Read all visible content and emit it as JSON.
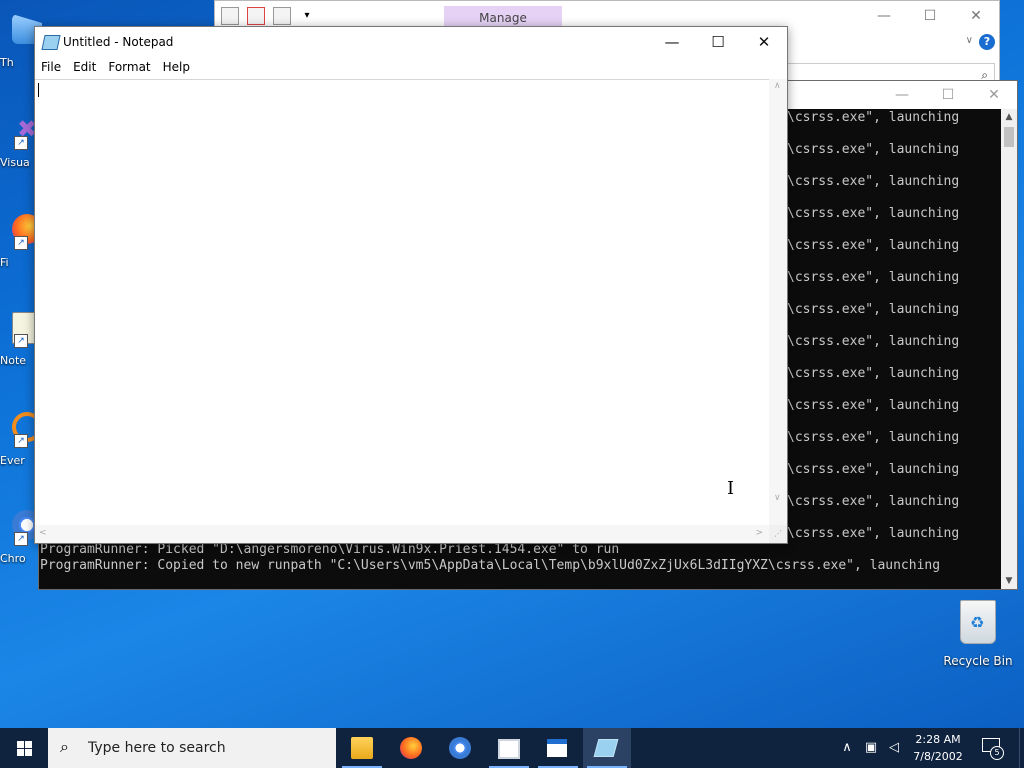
{
  "desktop": {
    "icons": [
      {
        "label": "Th"
      },
      {
        "label": "Visua"
      },
      {
        "label": "Fi"
      },
      {
        "label": "Note"
      },
      {
        "label": "Ever"
      },
      {
        "label": "Chro"
      }
    ],
    "recycle_bin_label": "Recycle Bin"
  },
  "explorer": {
    "manage_tab": "Manage",
    "title": "",
    "address_text": "",
    "minimize": "—",
    "maximize": "☐",
    "close": "✕",
    "help": "?"
  },
  "console": {
    "minimize": "—",
    "maximize": "☐",
    "close": "✕",
    "repeated_line": "\\csrss.exe\", launching",
    "repeated_line_count": 14,
    "picked_line": "ProgramRunner: Picked \"D:\\angersmoreno\\Virus.Win9x.Priest.1454.exe\" to run",
    "copied_line": "ProgramRunner: Copied to new runpath \"C:\\Users\\vm5\\AppData\\Local\\Temp\\b9xlUd0ZxZjUx6L3dIIgYXZ\\csrss.exe\", launching"
  },
  "notepad": {
    "title": "Untitled - Notepad",
    "menu": [
      "File",
      "Edit",
      "Format",
      "Help"
    ],
    "content": "",
    "minimize": "—",
    "maximize": "☐",
    "close": "✕"
  },
  "taskbar": {
    "search_placeholder": "Type here to search",
    "time": "2:28 AM",
    "date": "7/8/2002",
    "notification_count": "5",
    "pinned": [
      "file-explorer-icon",
      "firefox-icon",
      "chrome-icon",
      "app-window-icon",
      "console-app-icon",
      "notepad-icon"
    ]
  },
  "colors": {
    "desktop": "#0c6fd6",
    "taskbar": "#10233e",
    "console_bg": "#0c0c0c",
    "console_text": "#c8c8c8",
    "manage_tab_bg": "#e6d2f5"
  }
}
